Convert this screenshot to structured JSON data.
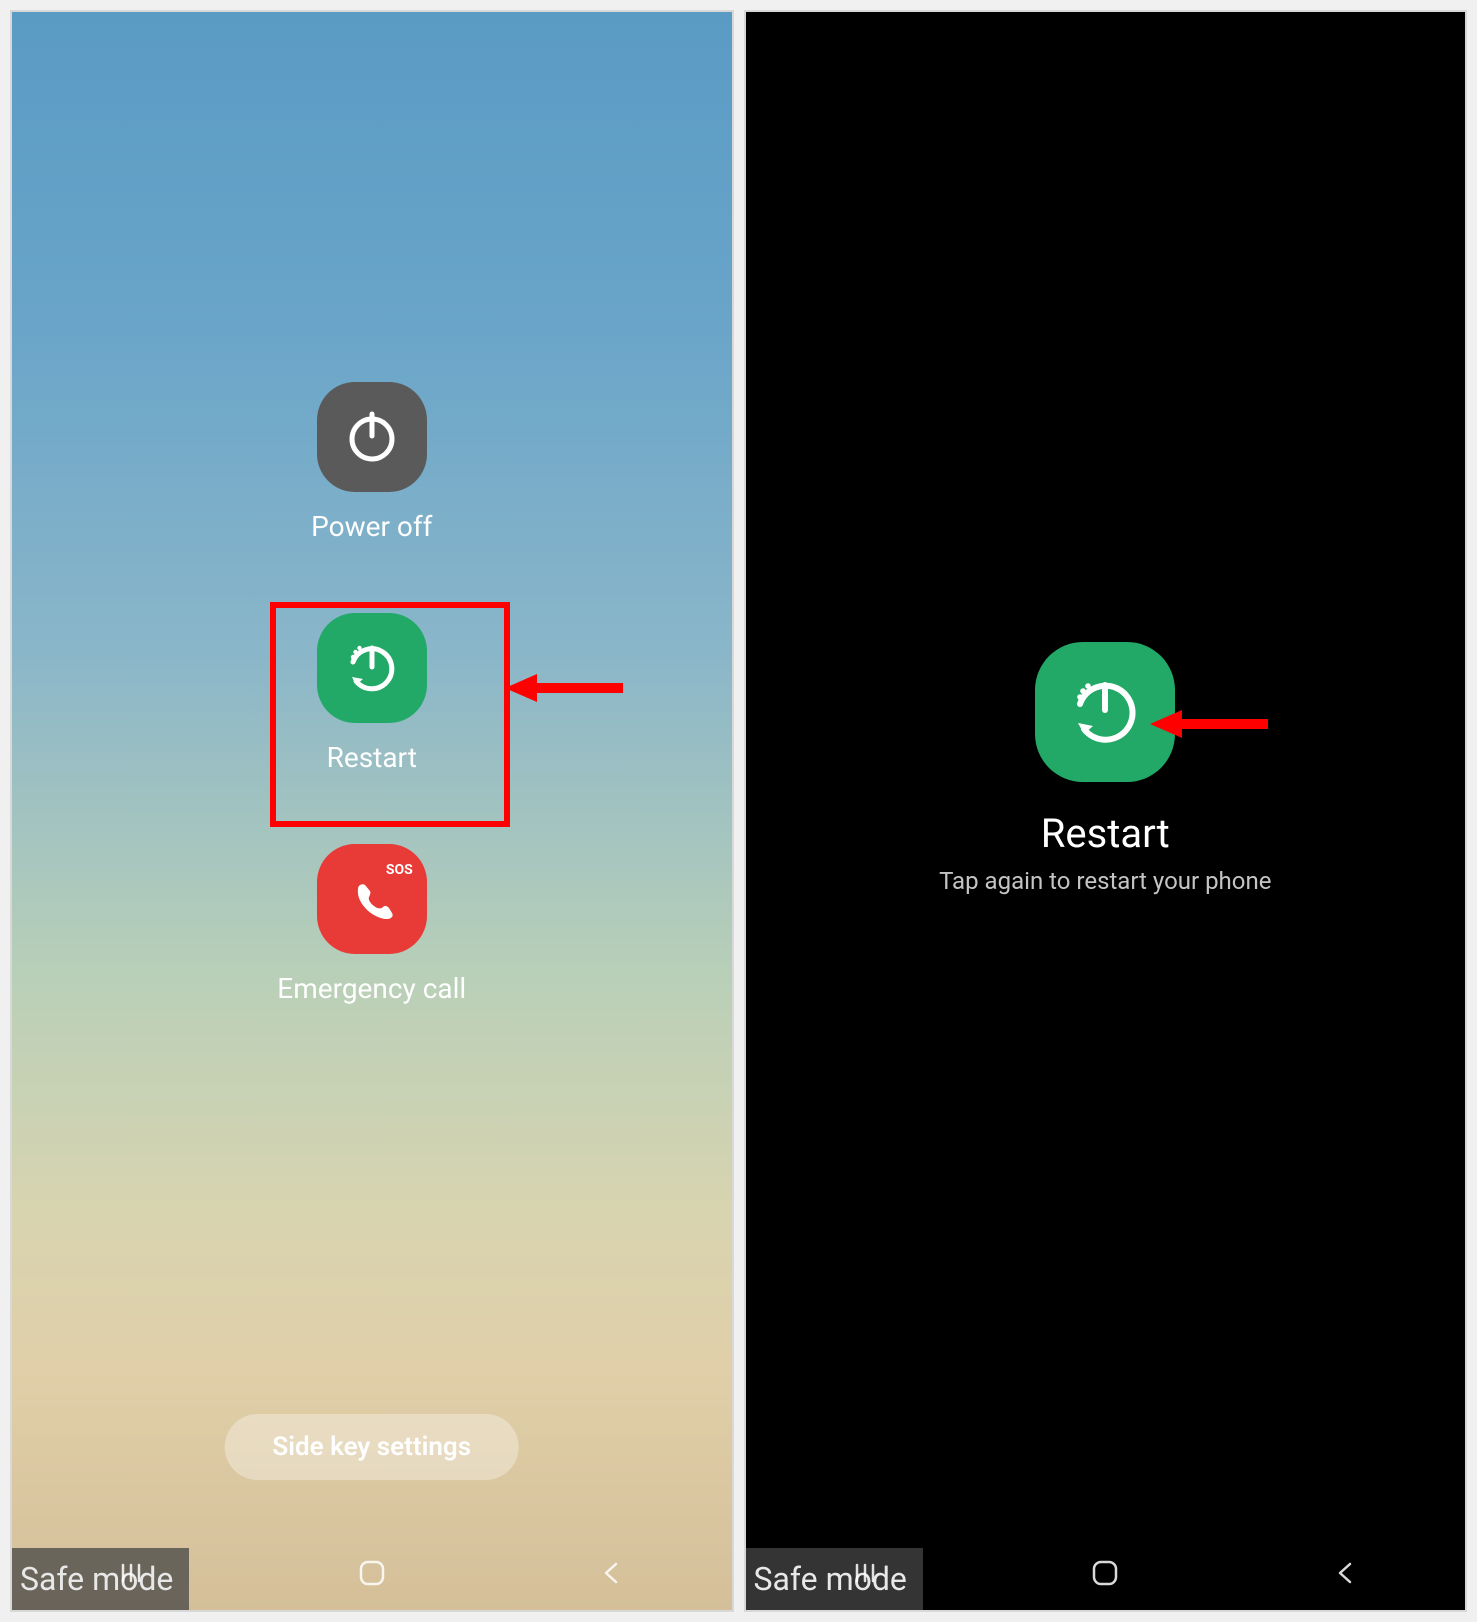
{
  "left": {
    "power_off_label": "Power off",
    "restart_label": "Restart",
    "emergency_label": "Emergency call",
    "emergency_sos": "SOS",
    "side_key_label": "Side key settings",
    "safe_mode_label": "Safe mode"
  },
  "right": {
    "restart_title": "Restart",
    "restart_subtitle": "Tap again to restart your phone",
    "safe_mode_label": "Safe mode"
  },
  "colors": {
    "highlight": "#ff0000",
    "restart_bg": "#22a968",
    "poweroff_bg": "#5a5a5a",
    "emergency_bg": "#e83a36"
  }
}
